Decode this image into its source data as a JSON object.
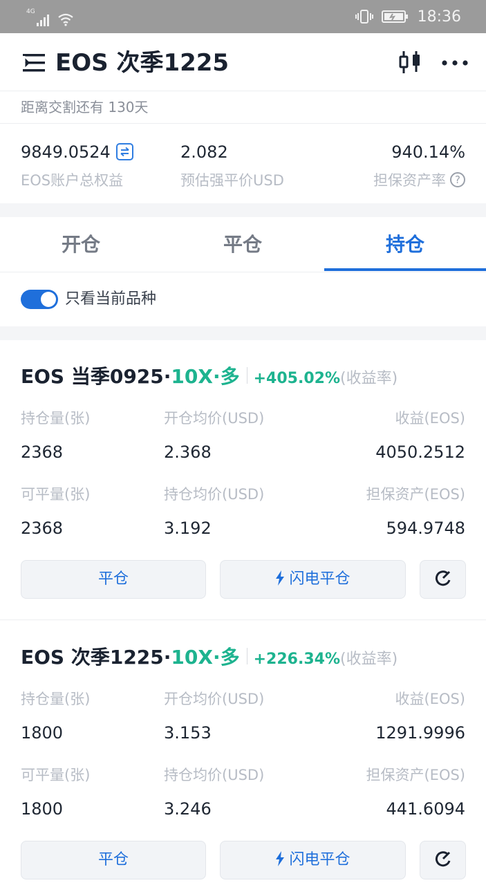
{
  "status_bar": {
    "network": "4G",
    "time": "18:36",
    "icons": [
      "signal-icon",
      "wifi-icon",
      "vibrate-icon",
      "battery-icon"
    ]
  },
  "header": {
    "title": "EOS 次季1225",
    "icons": [
      "menu-icon",
      "kline-chart-icon",
      "more-icon"
    ]
  },
  "countdown": "距离交割还有 130天",
  "account": {
    "equity_value": "9849.0524",
    "equity_label": "EOS账户总权益",
    "liq_value": "2.082",
    "liq_label": "预估强平价USD",
    "margin_ratio_value": "940.14%",
    "margin_ratio_label": "担保资产率"
  },
  "tabs": [
    {
      "label": "开仓",
      "active": false
    },
    {
      "label": "平仓",
      "active": false
    },
    {
      "label": "持仓",
      "active": true
    }
  ],
  "filter": {
    "label": "只看当前品种",
    "enabled": true
  },
  "positions": [
    {
      "name": "EOS 当季0925·",
      "leverage": "10X·多",
      "rate": "+405.02%",
      "rate_label": "(收益率)",
      "qty_label": "持仓量(张)",
      "qty": "2368",
      "open_avg_label": "开仓均价(USD)",
      "open_avg": "2.368",
      "pnl_label": "收益(EOS)",
      "pnl": "4050.2512",
      "closable_label": "可平量(张)",
      "closable": "2368",
      "hold_avg_label": "持仓均价(USD)",
      "hold_avg": "3.192",
      "margin_label": "担保资产(EOS)",
      "margin": "594.9748",
      "close_btn": "平仓",
      "flash_btn": "闪电平仓"
    },
    {
      "name": "EOS 次季1225·",
      "leverage": "10X·多",
      "rate": "+226.34%",
      "rate_label": "(收益率)",
      "qty_label": "持仓量(张)",
      "qty": "1800",
      "open_avg_label": "开仓均价(USD)",
      "open_avg": "3.153",
      "pnl_label": "收益(EOS)",
      "pnl": "1291.9996",
      "closable_label": "可平量(张)",
      "closable": "1800",
      "hold_avg_label": "持仓均价(USD)",
      "hold_avg": "3.246",
      "margin_label": "担保资产(EOS)",
      "margin": "441.6094",
      "close_btn": "平仓",
      "flash_btn": "闪电平仓"
    }
  ],
  "colors": {
    "accent": "#1f6fdb",
    "profit": "#1db38f",
    "muted": "#b7bcc5",
    "status_bar": "#9b9b9b"
  }
}
